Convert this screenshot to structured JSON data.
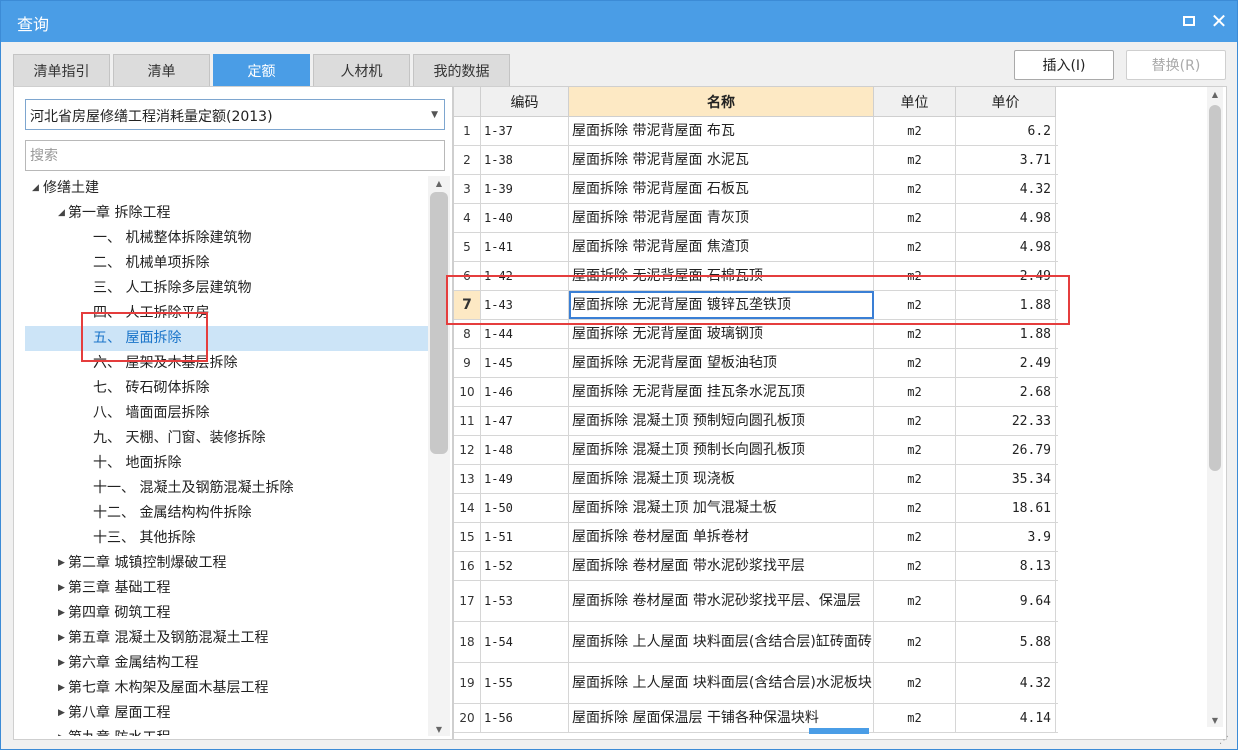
{
  "window": {
    "title": "查询"
  },
  "tabs": [
    {
      "label": "清单指引",
      "active": false
    },
    {
      "label": "清单",
      "active": false
    },
    {
      "label": "定额",
      "active": true
    },
    {
      "label": "人材机",
      "active": false
    },
    {
      "label": "我的数据",
      "active": false
    }
  ],
  "toolbar": {
    "insert_label": "插入(I)",
    "replace_label": "替换(R)"
  },
  "left": {
    "library": "河北省房屋修缮工程消耗量定额(2013)",
    "search_placeholder": "搜索",
    "tree": [
      {
        "label": "修缮土建",
        "level": 0,
        "expander": "open"
      },
      {
        "label": "第一章 拆除工程",
        "level": 1,
        "expander": "open"
      },
      {
        "label": "一、 机械整体拆除建筑物",
        "level": 2
      },
      {
        "label": "二、 机械单项拆除",
        "level": 2
      },
      {
        "label": "三、 人工拆除多层建筑物",
        "level": 2
      },
      {
        "label": "四、 人工拆除平房",
        "level": 2
      },
      {
        "label": "五、 屋面拆除",
        "level": 2,
        "selected": true
      },
      {
        "label": "六、 屋架及木基层拆除",
        "level": 2
      },
      {
        "label": "七、 砖石砌体拆除",
        "level": 2
      },
      {
        "label": "八、 墙面面层拆除",
        "level": 2
      },
      {
        "label": "九、 天棚、门窗、装修拆除",
        "level": 2
      },
      {
        "label": "十、 地面拆除",
        "level": 2
      },
      {
        "label": "十一、 混凝土及钢筋混凝土拆除",
        "level": 2
      },
      {
        "label": "十二、 金属结构构件拆除",
        "level": 2
      },
      {
        "label": "十三、 其他拆除",
        "level": 2
      },
      {
        "label": "第二章 城镇控制爆破工程",
        "level": 1,
        "expander": "closed"
      },
      {
        "label": "第三章 基础工程",
        "level": 1,
        "expander": "closed"
      },
      {
        "label": "第四章 砌筑工程",
        "level": 1,
        "expander": "closed"
      },
      {
        "label": "第五章 混凝土及钢筋混凝土工程",
        "level": 1,
        "expander": "closed"
      },
      {
        "label": "第六章 金属结构工程",
        "level": 1,
        "expander": "closed"
      },
      {
        "label": "第七章 木构架及屋面木基层工程",
        "level": 1,
        "expander": "closed"
      },
      {
        "label": "第八章 屋面工程",
        "level": 1,
        "expander": "closed"
      },
      {
        "label": "第九章 防水工程",
        "level": 1,
        "expander": "closed"
      }
    ]
  },
  "grid": {
    "columns": {
      "code": "编码",
      "name": "名称",
      "unit": "单位",
      "price": "单价"
    },
    "current_row": 7,
    "rows": [
      {
        "idx": "1",
        "code": "1-37",
        "name": "屋面拆除 带泥背屋面 布瓦",
        "unit": "m2",
        "price": "6.2"
      },
      {
        "idx": "2",
        "code": "1-38",
        "name": "屋面拆除 带泥背屋面 水泥瓦",
        "unit": "m2",
        "price": "3.71"
      },
      {
        "idx": "3",
        "code": "1-39",
        "name": "屋面拆除 带泥背屋面 石板瓦",
        "unit": "m2",
        "price": "4.32"
      },
      {
        "idx": "4",
        "code": "1-40",
        "name": "屋面拆除 带泥背屋面 青灰顶",
        "unit": "m2",
        "price": "4.98"
      },
      {
        "idx": "5",
        "code": "1-41",
        "name": "屋面拆除 带泥背屋面 焦渣顶",
        "unit": "m2",
        "price": "4.98"
      },
      {
        "idx": "6",
        "code": "1-42",
        "name": "屋面拆除 无泥背屋面 石棉瓦顶",
        "unit": "m2",
        "price": "2.49"
      },
      {
        "idx": "7",
        "code": "1-43",
        "name": "屋面拆除 无泥背屋面 镀锌瓦垄铁顶",
        "unit": "m2",
        "price": "1.88"
      },
      {
        "idx": "8",
        "code": "1-44",
        "name": "屋面拆除 无泥背屋面 玻璃钢顶",
        "unit": "m2",
        "price": "1.88"
      },
      {
        "idx": "9",
        "code": "1-45",
        "name": "屋面拆除 无泥背屋面 望板油毡顶",
        "unit": "m2",
        "price": "2.49"
      },
      {
        "idx": "10",
        "code": "1-46",
        "name": "屋面拆除 无泥背屋面 挂瓦条水泥瓦顶",
        "unit": "m2",
        "price": "2.68"
      },
      {
        "idx": "11",
        "code": "1-47",
        "name": "屋面拆除 混凝土顶 预制短向圆孔板顶",
        "unit": "m2",
        "price": "22.33"
      },
      {
        "idx": "12",
        "code": "1-48",
        "name": "屋面拆除 混凝土顶 预制长向圆孔板顶",
        "unit": "m2",
        "price": "26.79"
      },
      {
        "idx": "13",
        "code": "1-49",
        "name": "屋面拆除 混凝土顶 现浇板",
        "unit": "m2",
        "price": "35.34"
      },
      {
        "idx": "14",
        "code": "1-50",
        "name": "屋面拆除 混凝土顶 加气混凝土板",
        "unit": "m2",
        "price": "18.61"
      },
      {
        "idx": "15",
        "code": "1-51",
        "name": "屋面拆除 卷材屋面 单拆卷材",
        "unit": "m2",
        "price": "3.9"
      },
      {
        "idx": "16",
        "code": "1-52",
        "name": "屋面拆除 卷材屋面 带水泥砂浆找平层",
        "unit": "m2",
        "price": "8.13"
      },
      {
        "idx": "17",
        "code": "1-53",
        "name": "屋面拆除 卷材屋面 带水泥砂浆找平层、保温层",
        "unit": "m2",
        "price": "9.64"
      },
      {
        "idx": "18",
        "code": "1-54",
        "name": "屋面拆除 上人屋面 块料面层(含结合层)缸砖面砖",
        "unit": "m2",
        "price": "5.88"
      },
      {
        "idx": "19",
        "code": "1-55",
        "name": "屋面拆除 上人屋面 块料面层(含结合层)水泥板块",
        "unit": "m2",
        "price": "4.32"
      },
      {
        "idx": "20",
        "code": "1-56",
        "name": "屋面拆除 屋面保温层 干铺各种保温块料",
        "unit": "m2",
        "price": "4.14"
      }
    ]
  }
}
